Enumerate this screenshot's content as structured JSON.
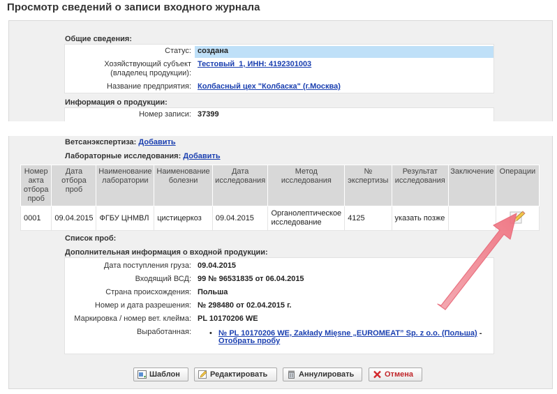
{
  "title": "Просмотр сведений о записи входного журнала",
  "general": {
    "heading": "Общие сведения:",
    "status_label": "Статус:",
    "status_value": "создана",
    "owner_label_1": "Хозяйствующий субъект",
    "owner_label_2": "(владелец продукции):",
    "owner_value": "Тестовый_1, ИНН: 4192301003",
    "enterprise_label": "Название предприятия:",
    "enterprise_value": "Колбасный цех \"Колбаска\" (г.Москва)"
  },
  "product_info": {
    "heading": "Информация о продукции:",
    "record_label": "Номер записи:",
    "record_value": "37399"
  },
  "vet": {
    "heading": "Ветсанэкспертиза:",
    "add_link": "Добавить"
  },
  "lab": {
    "heading": "Лабораторные исследования:",
    "add_link": "Добавить",
    "columns": [
      "Номер акта отбора проб",
      "Дата отбора проб",
      "Наименование лаборатории",
      "Наименование болезни",
      "Дата исследования",
      "Метод исследования",
      "№ экспертизы",
      "Результат исследования",
      "Заключение",
      "Операции"
    ],
    "rows": [
      [
        "0001",
        "09.04.2015",
        "ФГБУ ЦНМВЛ",
        "цистицеркоз",
        "09.04.2015",
        "Органолептическое исследование",
        "4125",
        "указать позже",
        "",
        ""
      ]
    ]
  },
  "samples": {
    "heading": "Список проб:"
  },
  "additional": {
    "heading": "Дополнительная информация о входной продукции:",
    "arrival_label": "Дата поступления груза:",
    "arrival_value": "09.04.2015",
    "vsd_label": "Входящий ВСД:",
    "vsd_value": "99 № 96531835 от 06.04.2015",
    "country_label": "Страна происхождения:",
    "country_value": "Польша",
    "permit_label": "Номер и дата разрешения:",
    "permit_value": "№ 298480 от 02.04.2015 г.",
    "marking_label": "Маркировка / номер вет. клейма:",
    "marking_value": "PL 10170206 WE",
    "produced_label": "Выработанная:",
    "produced_link": "№ PL 10170206 WE, Zakłady Mięsne „EUROMEAT” Sp. z o.o. (Польша)",
    "produced_dash": " -",
    "sample_link": "Отобрать пробу"
  },
  "buttons": {
    "template": "Шаблон",
    "edit": "Редактировать",
    "annul": "Аннулировать",
    "cancel": "Отмена"
  },
  "icons": {
    "edit": "pencil-icon",
    "template": "template-icon",
    "annul": "trash-icon",
    "cancel": "cross-icon"
  },
  "colors": {
    "status_highlight": "#bfe0f8",
    "link": "#1a3fb0",
    "arrow": "#f4838f"
  }
}
